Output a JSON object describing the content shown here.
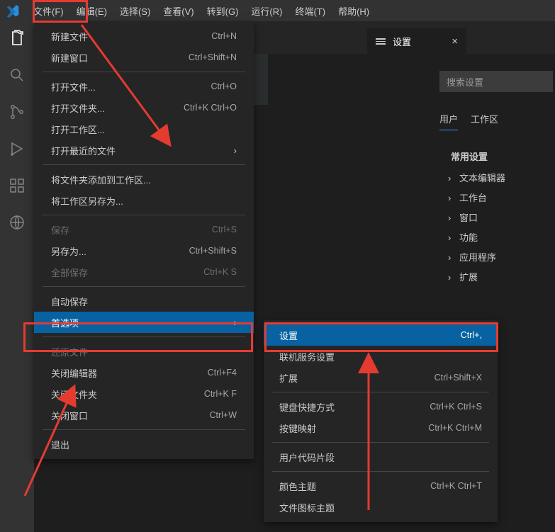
{
  "menubar": {
    "file": "文件(F)",
    "edit": "编辑(E)",
    "select": "选择(S)",
    "view": "查看(V)",
    "go": "转到(G)",
    "run": "运行(R)",
    "terminal": "终端(T)",
    "help": "帮助(H)"
  },
  "fileMenu": {
    "newFile": {
      "label": "新建文件",
      "kbd": "Ctrl+N"
    },
    "newWindow": {
      "label": "新建窗口",
      "kbd": "Ctrl+Shift+N"
    },
    "openFile": {
      "label": "打开文件...",
      "kbd": "Ctrl+O"
    },
    "openFolder": {
      "label": "打开文件夹...",
      "kbd": "Ctrl+K Ctrl+O"
    },
    "openWorkspace": {
      "label": "打开工作区...",
      "kbd": ""
    },
    "openRecent": {
      "label": "打开最近的文件",
      "kbd": ""
    },
    "addFolder": {
      "label": "将文件夹添加到工作区...",
      "kbd": ""
    },
    "saveWorkspaceAs": {
      "label": "将工作区另存为...",
      "kbd": ""
    },
    "save": {
      "label": "保存",
      "kbd": "Ctrl+S"
    },
    "saveAs": {
      "label": "另存为...",
      "kbd": "Ctrl+Shift+S"
    },
    "saveAll": {
      "label": "全部保存",
      "kbd": "Ctrl+K S"
    },
    "autoSave": {
      "label": "自动保存",
      "kbd": ""
    },
    "preferences": {
      "label": "首选项",
      "kbd": ""
    },
    "revert": {
      "label": "还原文件",
      "kbd": ""
    },
    "closeEditor": {
      "label": "关闭编辑器",
      "kbd": "Ctrl+F4"
    },
    "closeFolder": {
      "label": "关闭文件夹",
      "kbd": "Ctrl+K F"
    },
    "closeWindow": {
      "label": "关闭窗口",
      "kbd": "Ctrl+W"
    },
    "exit": {
      "label": "退出",
      "kbd": ""
    }
  },
  "prefSubmenu": {
    "settings": {
      "label": "设置",
      "kbd": "Ctrl+,"
    },
    "onlineServices": {
      "label": "联机服务设置",
      "kbd": ""
    },
    "extensions": {
      "label": "扩展",
      "kbd": "Ctrl+Shift+X"
    },
    "keyboardShortcuts": {
      "label": "键盘快捷方式",
      "kbd": "Ctrl+K Ctrl+S"
    },
    "keymaps": {
      "label": "按键映射",
      "kbd": "Ctrl+K Ctrl+M"
    },
    "userSnippets": {
      "label": "用户代码片段",
      "kbd": ""
    },
    "colorTheme": {
      "label": "颜色主题",
      "kbd": "Ctrl+K Ctrl+T"
    },
    "iconTheme": {
      "label": "文件图标主题",
      "kbd": ""
    }
  },
  "settingsEditor": {
    "tabLabel": "设置",
    "searchPlaceholder": "搜索设置",
    "scopeUser": "用户",
    "scopeWorkspace": "工作区",
    "tree": {
      "common": "常用设置",
      "textEditor": "文本编辑器",
      "workbench": "工作台",
      "window": "窗口",
      "features": "功能",
      "application": "应用程序",
      "extensions": "扩展"
    }
  }
}
